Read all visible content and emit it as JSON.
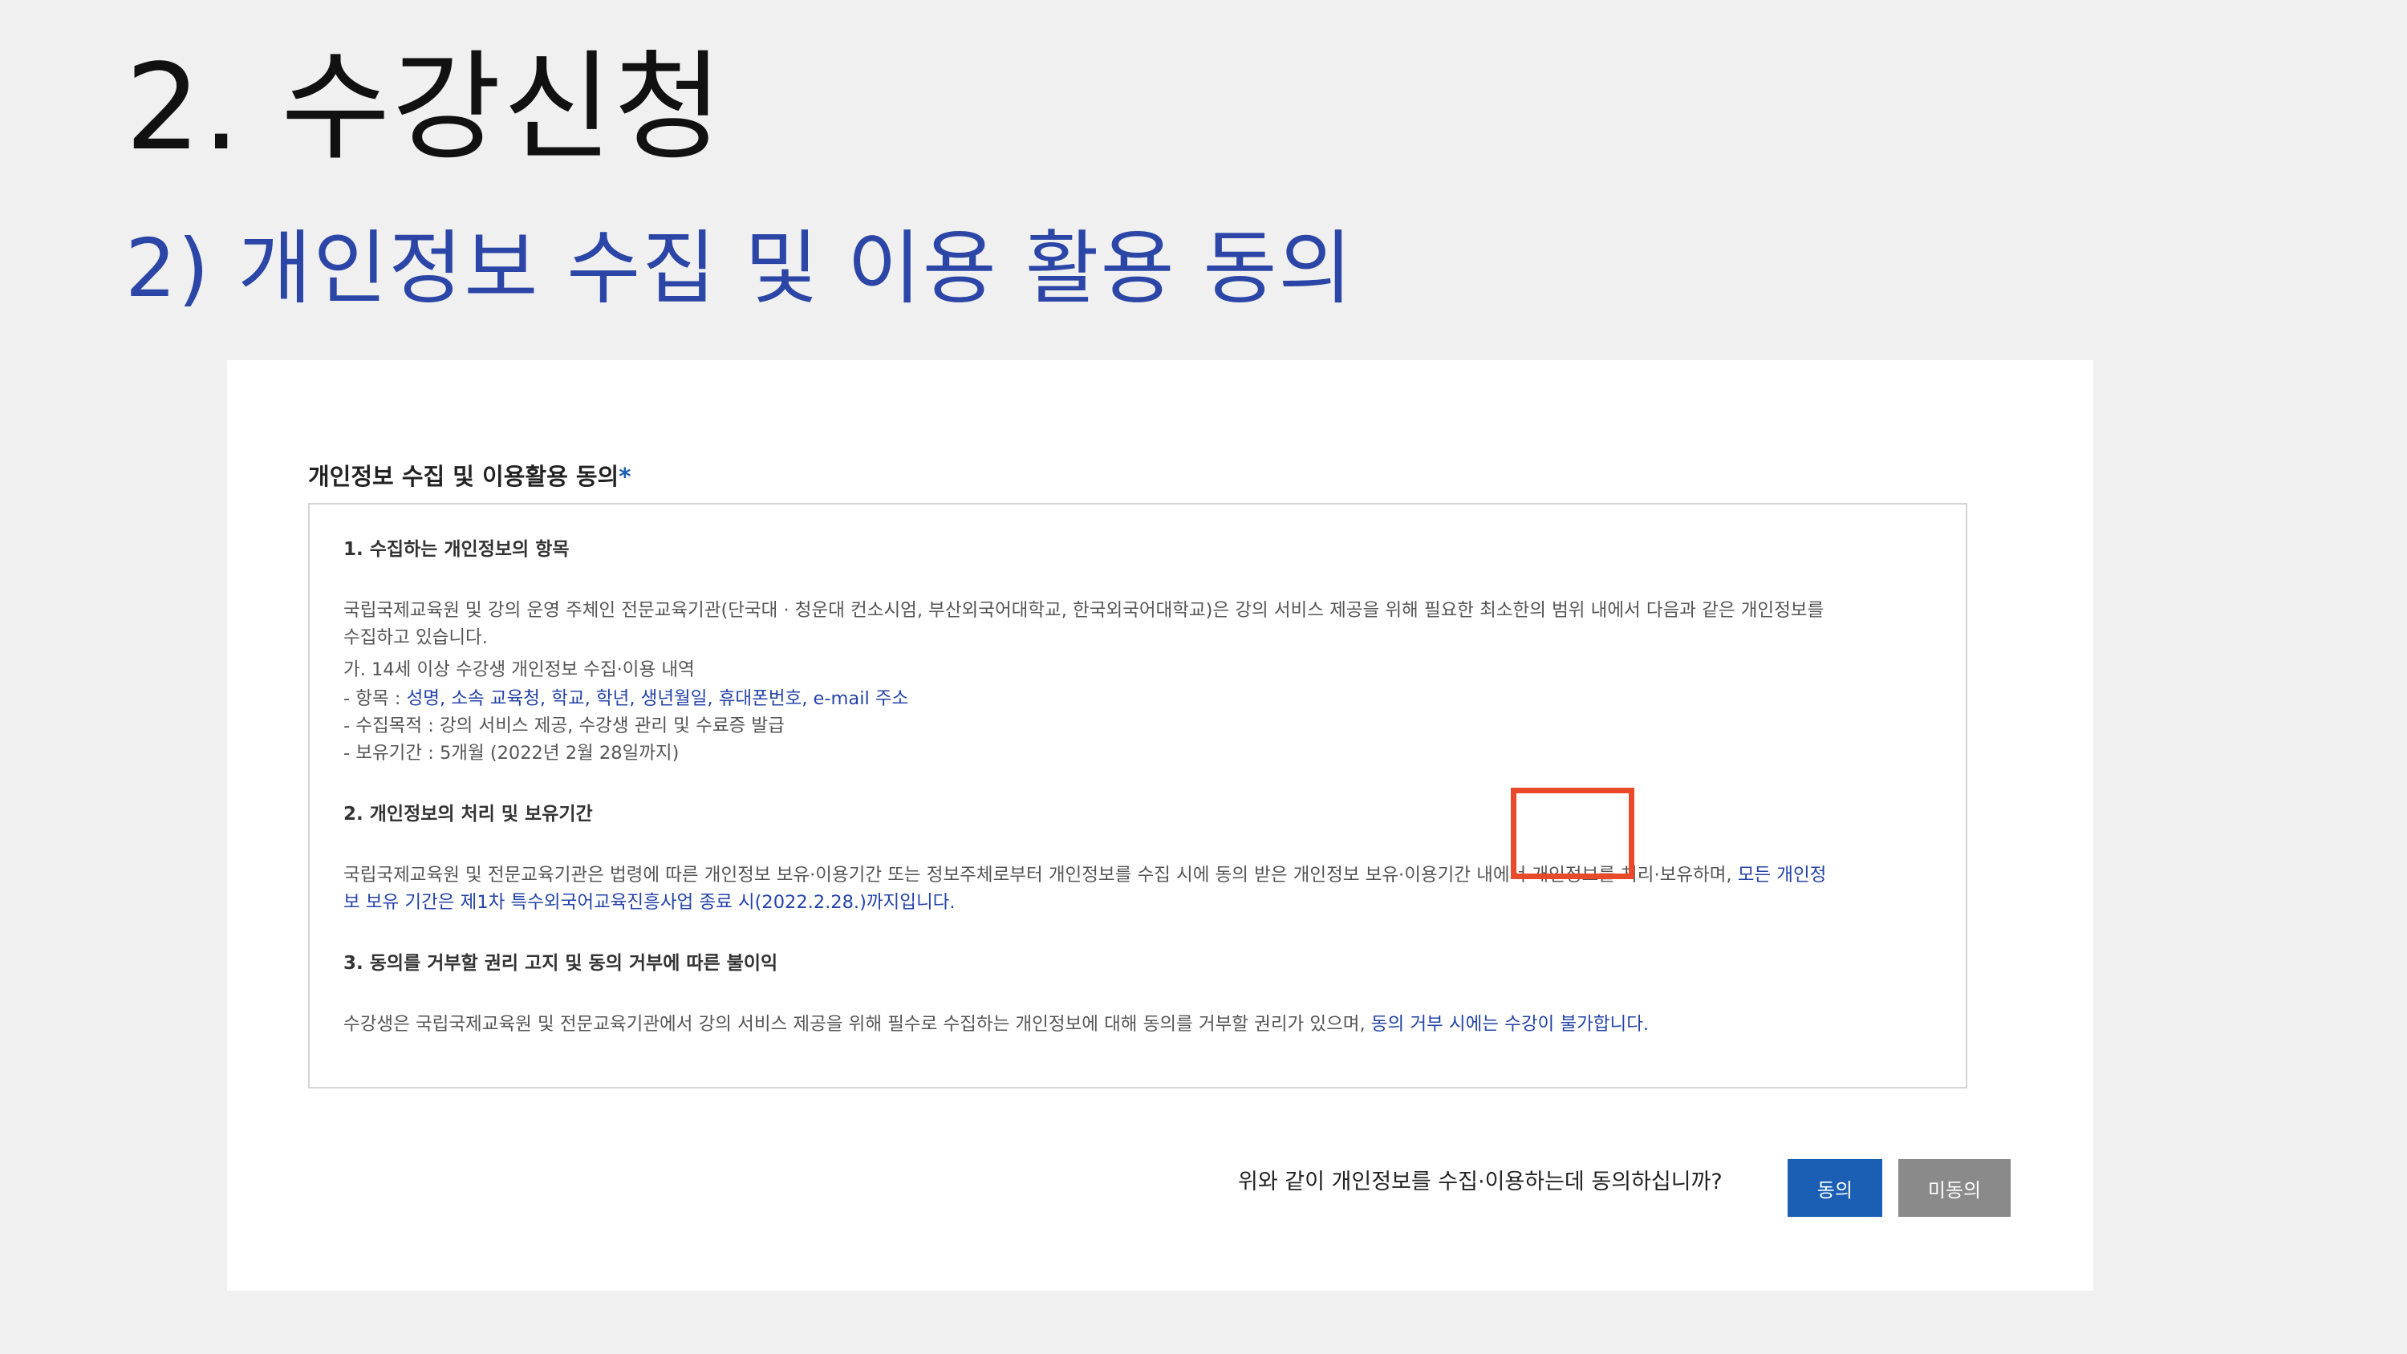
{
  "slide": {
    "title": "2. 수강신청",
    "subtitle": "2) 개인정보 수집 및 이용 활용 동의"
  },
  "form": {
    "heading": "개인정보 수집 및 이용활용 동의",
    "required_mark": "*",
    "sections": {
      "s1_title": "1. 수집하는 개인정보의 항목",
      "s1_body_line1": "국립국제교육원 및 강의 운영 주체인 전문교육기관(단국대 · 청운대 컨소시엄, 부산외국어대학교, 한국외국어대학교)은 강의 서비스 제공을 위해 필요한 최소한의 범위 내에서 다음과 같은 개인정보를",
      "s1_body_line2": "수집하고 있습니다.",
      "s1_sub_title": "가. 14세 이상 수강생 개인정보 수집·이용 내역",
      "s1_items_label": "- 항목 : ",
      "s1_items_value": "성명, 소속 교육청, 학교, 학년, 생년월일, 휴대폰번호, e-mail 주소",
      "s1_purpose": "- 수집목적 : 강의 서비스 제공, 수강생 관리 및 수료증 발급",
      "s1_retention": "- 보유기간 : 5개월 (2022년 2월 28일까지)",
      "s2_title": "2. 개인정보의 처리 및 보유기간",
      "s2_body_line1_plain": "국립국제교육원 및 전문교육기관은 법령에 따른 개인정보 보유·이용기간 또는 정보주체로부터 개인정보를 수집 시에 동의 받은 개인정보 보유·이용기간 내에서 개인정보를 처리·보유하며, ",
      "s2_body_line1_blue": "모든 개인정",
      "s2_body_line2_blue": "보 보유 기간은 제1차 특수외국어교육진흥사업 종료 시(2022.2.28.)까지입니다.",
      "s3_title": "3. 동의를 거부할 권리 고지 및 동의 거부에 따른 불이익",
      "s3_body_plain": "수강생은 국립국제교육원 및 전문교육기관에서 강의 서비스 제공을 위해 필수로 수집하는 개인정보에 대해 동의를 거부할 권리가 있으며, ",
      "s3_body_blue": "동의 거부 시에는 수강이 불가합니다."
    },
    "question": "위와 같이 개인정보를 수집·이용하는데 동의하십니까?",
    "agree_label": "동의",
    "disagree_label": "미동의"
  },
  "colors": {
    "accent_blue": "#1a5fb4",
    "subtitle_blue": "#2b46a6",
    "link_blue": "#2443a8",
    "highlight_red": "#e84a2a",
    "disagree_gray": "#8a8a8a"
  }
}
